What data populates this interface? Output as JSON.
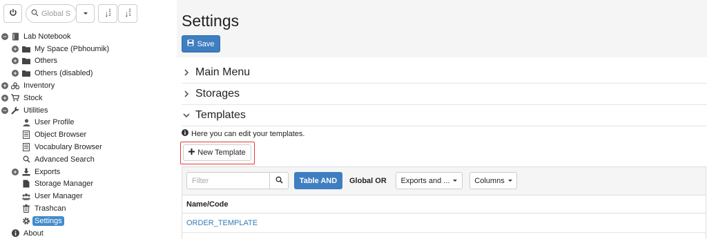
{
  "sidebar": {
    "search": {
      "placeholder": "Global S"
    },
    "sort_asc_label": "↓",
    "sort_desc_label": "↓",
    "tree": [
      {
        "label": "Lab Notebook",
        "toggle": "minus",
        "icon": "notebook-icon",
        "depth": 0
      },
      {
        "label": "My Space (Pbhoumik)",
        "toggle": "plus",
        "icon": "folder-icon",
        "depth": 1
      },
      {
        "label": "Others",
        "toggle": "plus",
        "icon": "folder-icon",
        "depth": 1
      },
      {
        "label": "Others (disabled)",
        "toggle": "plus",
        "icon": "folder-icon",
        "depth": 1
      },
      {
        "label": "Inventory",
        "toggle": "plus",
        "icon": "inventory-icon",
        "depth": 0
      },
      {
        "label": "Stock",
        "toggle": "plus",
        "icon": "cart-icon",
        "depth": 0
      },
      {
        "label": "Utilities",
        "toggle": "minus",
        "icon": "wrench-icon",
        "depth": 0
      },
      {
        "label": "User Profile",
        "toggle": "",
        "icon": "user-icon",
        "depth": 1
      },
      {
        "label": "Object Browser",
        "toggle": "",
        "icon": "list-icon",
        "depth": 1
      },
      {
        "label": "Vocabulary Browser",
        "toggle": "",
        "icon": "list-icon",
        "depth": 1
      },
      {
        "label": "Advanced Search",
        "toggle": "",
        "icon": "search-icon",
        "depth": 1
      },
      {
        "label": "Exports",
        "toggle": "plus",
        "icon": "export-icon",
        "depth": 1
      },
      {
        "label": "Storage Manager",
        "toggle": "",
        "icon": "document-icon",
        "depth": 1
      },
      {
        "label": "User Manager",
        "toggle": "",
        "icon": "users-icon",
        "depth": 1
      },
      {
        "label": "Trashcan",
        "toggle": "",
        "icon": "trash-icon",
        "depth": 1
      },
      {
        "label": "Settings",
        "toggle": "",
        "icon": "gear-icon",
        "depth": 1,
        "selected": true
      },
      {
        "label": "About",
        "toggle": "",
        "icon": "info-icon",
        "depth": 0
      }
    ]
  },
  "main": {
    "title": "Settings",
    "save_label": "Save",
    "sections": [
      {
        "label": "Main Menu",
        "expanded": false
      },
      {
        "label": "Storages",
        "expanded": false
      },
      {
        "label": "Templates",
        "expanded": true
      }
    ],
    "info_text": "Here you can edit your templates.",
    "new_template_label": "New Template",
    "grid": {
      "filter_placeholder": "Filter",
      "table_and_label": "Table AND",
      "global_or_label": "Global OR",
      "exports_label": "Exports and ...",
      "columns_label": "Columns",
      "column_header": "Name/Code",
      "rows": [
        "ORDER_TEMPLATE"
      ]
    }
  },
  "colors": {
    "primary": "#3f7ec1",
    "highlight": "#e53935",
    "link": "#337ab7"
  }
}
